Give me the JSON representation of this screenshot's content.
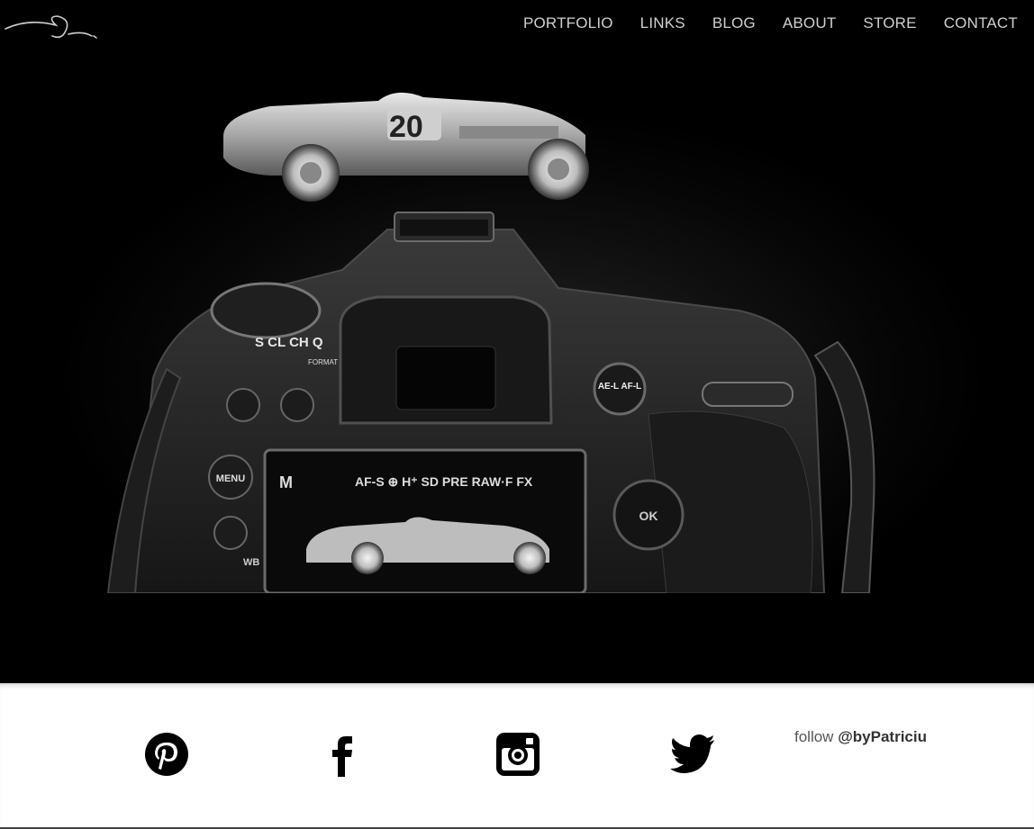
{
  "site": {
    "logo_icon": "signature-logo"
  },
  "nav": {
    "items": [
      {
        "label": "PORTFOLIO"
      },
      {
        "label": "LINKS"
      },
      {
        "label": "BLOG"
      },
      {
        "label": "ABOUT"
      },
      {
        "label": "STORE"
      },
      {
        "label": "CONTACT"
      }
    ]
  },
  "hero": {
    "image_subject_icon": "camera-photo",
    "screen_text": {
      "mode": "M",
      "settings": "AF-S ⊕ H⁺ SD PRE RAW·F FX",
      "car_number": "20",
      "menu": "MENU",
      "ok": "OK",
      "ael": "AE-L AF-L",
      "wb": "WB",
      "dial": "S CL CH Q",
      "format": "FORMAT"
    }
  },
  "footer": {
    "social": [
      {
        "icon": "pinterest-icon"
      },
      {
        "icon": "facebook-icon"
      },
      {
        "icon": "instagram-icon"
      },
      {
        "icon": "twitter-icon"
      }
    ],
    "follow_prefix": "follow",
    "follow_handle": "@byPatriciu"
  },
  "colors": {
    "hero_bg": "#000000",
    "nav_text": "#cfcfcf",
    "footer_bg": "#ffffff"
  }
}
